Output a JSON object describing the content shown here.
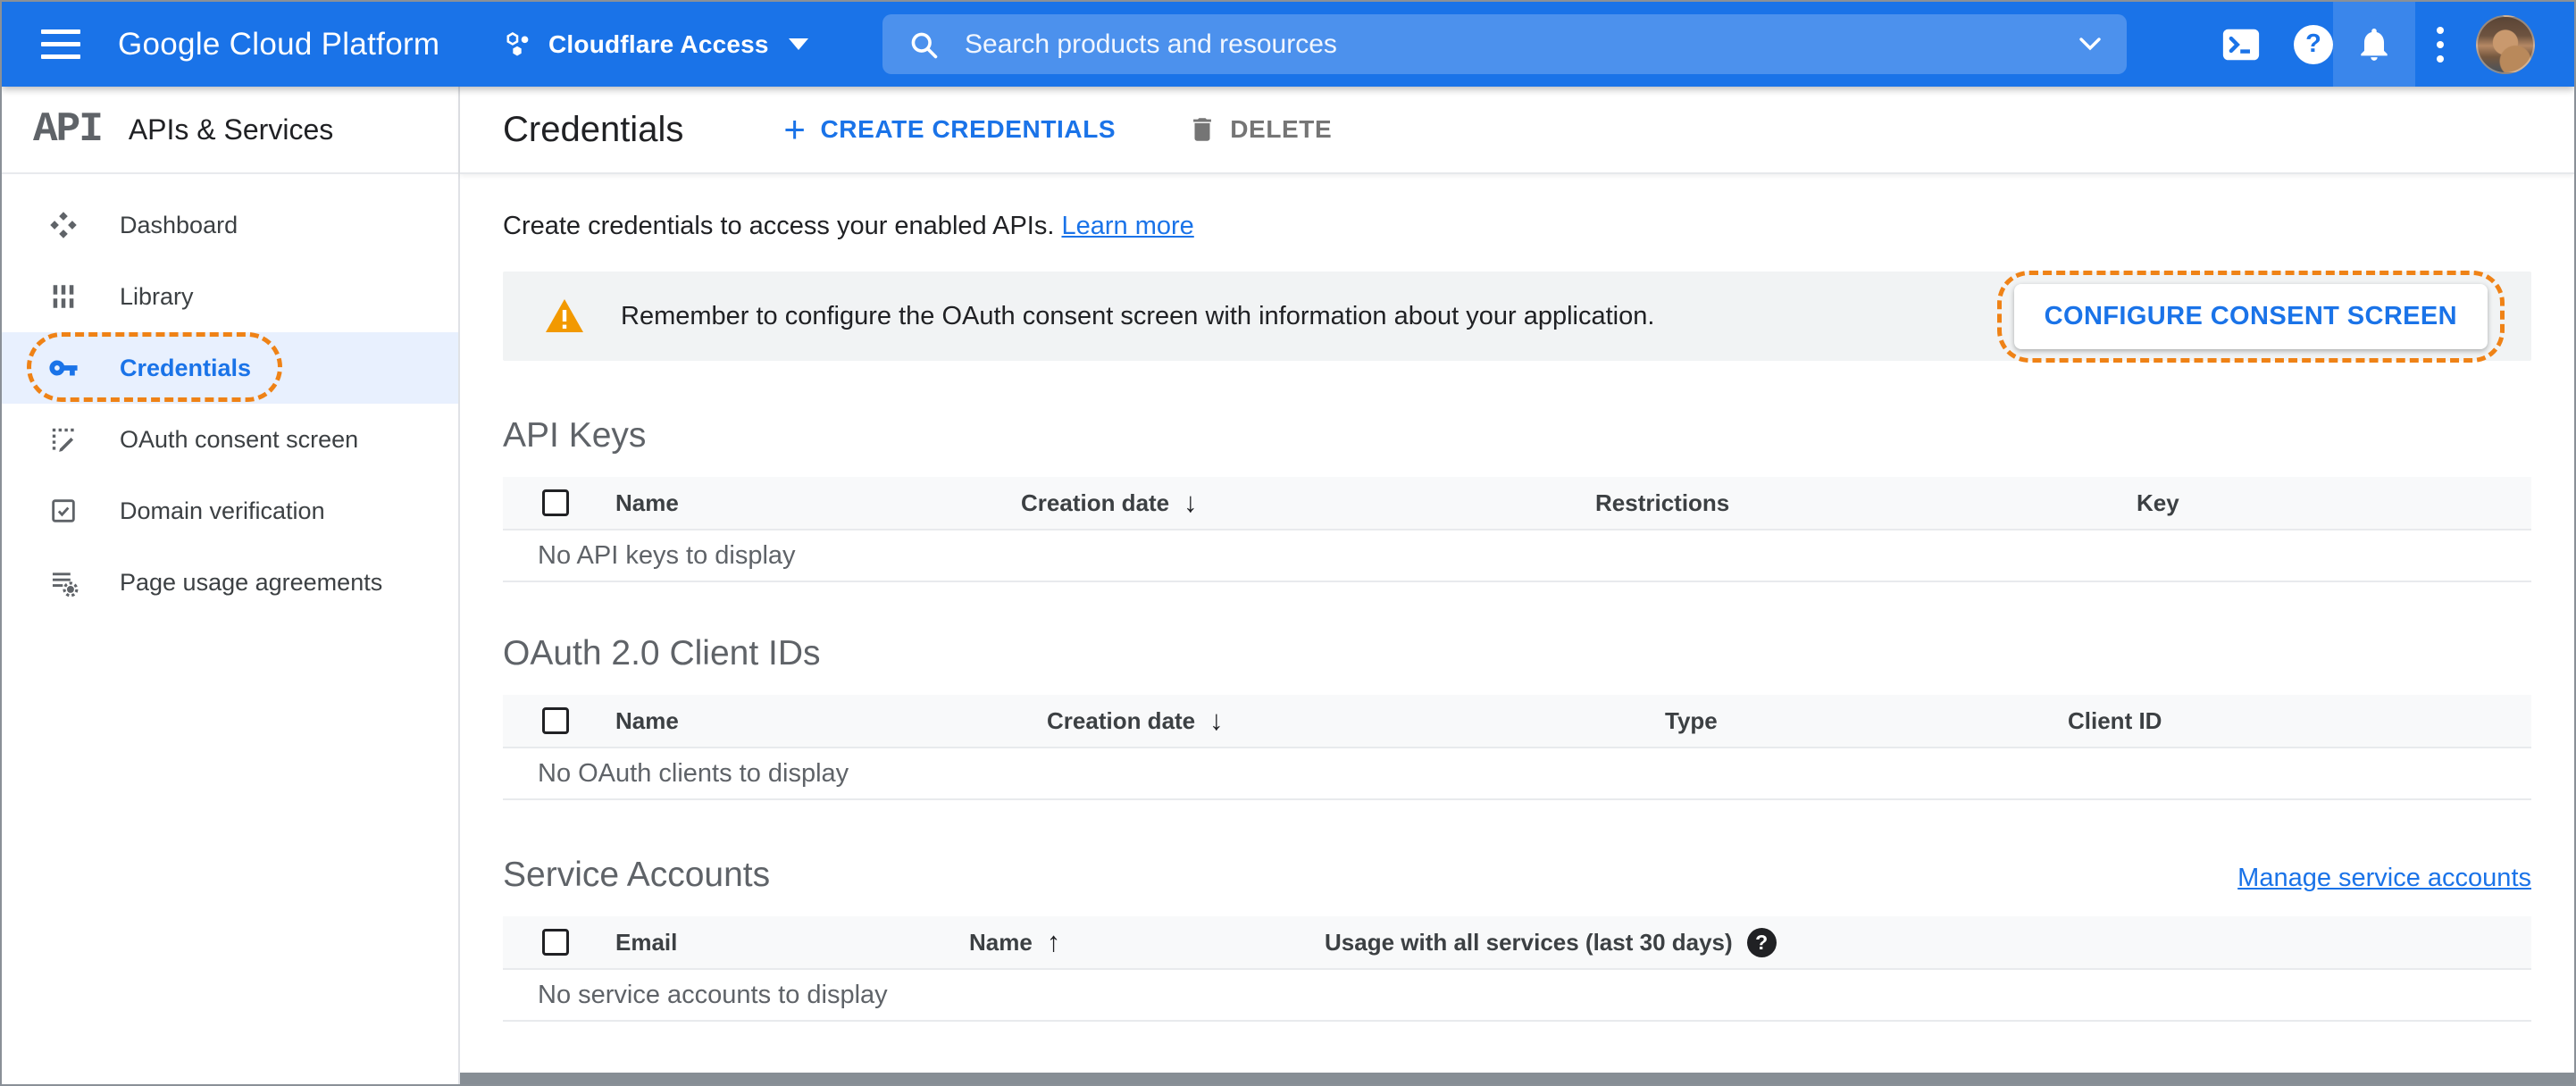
{
  "header": {
    "product_name": "Google Cloud Platform",
    "project_name": "Cloudflare Access",
    "search_placeholder": "Search products and resources",
    "help_glyph": "?"
  },
  "sidebar": {
    "logo_text": "API",
    "title": "APIs & Services",
    "items": [
      {
        "label": "Dashboard",
        "icon": "dashboard-icon",
        "selected": false
      },
      {
        "label": "Library",
        "icon": "library-icon",
        "selected": false
      },
      {
        "label": "Credentials",
        "icon": "key-icon",
        "selected": true,
        "annotated": true
      },
      {
        "label": "OAuth consent screen",
        "icon": "consent-screen-icon",
        "selected": false
      },
      {
        "label": "Domain verification",
        "icon": "domain-verification-icon",
        "selected": false
      },
      {
        "label": "Page usage agreements",
        "icon": "page-usage-agreements-icon",
        "selected": false
      }
    ]
  },
  "toolbar": {
    "title": "Credentials",
    "create_plus": "+",
    "create_label": "CREATE CREDENTIALS",
    "delete_label": "DELETE"
  },
  "intro": {
    "text": "Create credentials to access your enabled APIs.",
    "link_label": "Learn more"
  },
  "banner": {
    "message": "Remember to configure the OAuth consent screen with information about your application.",
    "button_label": "CONFIGURE CONSENT SCREEN"
  },
  "api_keys": {
    "title": "API Keys",
    "col_name": "Name",
    "col_creation": "Creation date",
    "sort_icon": "↓",
    "col_restrictions": "Restrictions",
    "col_key": "Key",
    "empty": "No API keys to display"
  },
  "oauth": {
    "title": "OAuth 2.0 Client IDs",
    "col_name": "Name",
    "col_creation": "Creation date",
    "sort_icon": "↓",
    "col_type": "Type",
    "col_client_id": "Client ID",
    "empty": "No OAuth clients to display"
  },
  "service_accounts": {
    "title": "Service Accounts",
    "manage_link": "Manage service accounts",
    "col_email": "Email",
    "col_name": "Name",
    "sort_icon": "↑",
    "col_usage": "Usage with all services (last 30 days)",
    "help_glyph": "?",
    "empty": "No service accounts to display"
  },
  "colors": {
    "header_blue": "#1a73e8",
    "accent_blue": "#1a73e8",
    "annotation_orange": "#ef8216",
    "warning_orange": "#f29900",
    "banner_gray": "#f1f3f4",
    "selected_nav_bg": "#e8f0fe",
    "table_header_bg": "#f8f9fa"
  }
}
